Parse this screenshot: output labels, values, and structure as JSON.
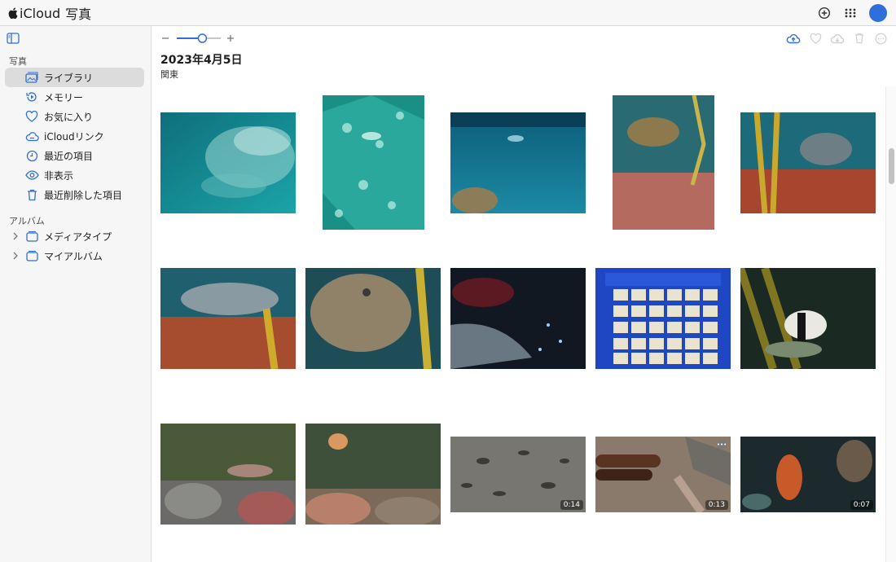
{
  "app": {
    "brand": "iCloud",
    "title": "写真"
  },
  "sidebar": {
    "photos_section": "写真",
    "items": [
      {
        "label": "ライブラリ",
        "icon": "library-icon",
        "selected": true
      },
      {
        "label": "メモリー",
        "icon": "memories-icon"
      },
      {
        "label": "お気に入り",
        "icon": "heart-icon"
      },
      {
        "label": "iCloudリンク",
        "icon": "cloud-link-icon"
      },
      {
        "label": "最近の項目",
        "icon": "clock-icon"
      },
      {
        "label": "非表示",
        "icon": "eye-hidden-icon"
      },
      {
        "label": "最近削除した項目",
        "icon": "trash-icon"
      }
    ],
    "albums_section": "アルバム",
    "albums": [
      {
        "label": "メディアタイプ",
        "icon": "folder-icon"
      },
      {
        "label": "マイアルバム",
        "icon": "folder-icon"
      }
    ]
  },
  "toolbar": {
    "zoom_level": 0.6
  },
  "content": {
    "date": "2023年4月5日",
    "location": "関東",
    "videos": [
      {
        "duration": "0:14"
      },
      {
        "duration": "0:13"
      },
      {
        "duration": "0:07"
      }
    ],
    "more_badge": "•••"
  },
  "colors": {
    "accent": "#2f6fdc",
    "selected_row": "#dcdcdc",
    "sidebar_bg": "#f6f6f6"
  }
}
